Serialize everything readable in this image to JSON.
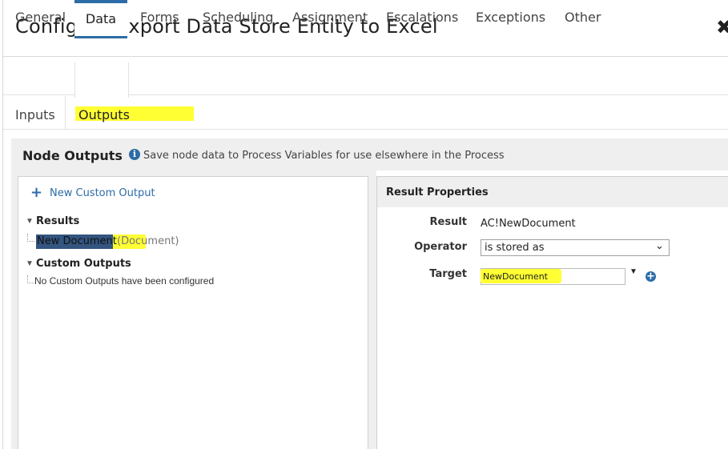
{
  "window": {
    "title": "Configure Export Data Store Entity to Excel",
    "close_glyph": "✖"
  },
  "tabs": [
    {
      "label": "General"
    },
    {
      "label": "Data"
    },
    {
      "label": "Forms"
    },
    {
      "label": "Scheduling"
    },
    {
      "label": "Assignment"
    },
    {
      "label": "Escalations"
    },
    {
      "label": "Exceptions"
    },
    {
      "label": "Other"
    }
  ],
  "active_tab": "Data",
  "subtabs": [
    {
      "label": "Inputs"
    },
    {
      "label": "Outputs"
    }
  ],
  "active_subtab": "Outputs",
  "node_outputs": {
    "title": "Node Outputs",
    "info": "Save node data to Process Variables for use elsewhere in the Process"
  },
  "tree": {
    "new_custom_output": "New Custom Output",
    "results_label": "Results",
    "result_item": {
      "name": "New Document",
      "type": "(Document)"
    },
    "custom_outputs_label": "Custom Outputs",
    "custom_empty": "No Custom Outputs have been configured"
  },
  "result_properties": {
    "title": "Result Properties",
    "result_label": "Result",
    "result_value": "AC!NewDocument",
    "operator_label": "Operator",
    "operator_value": "is stored as",
    "target_label": "Target",
    "target_value": "NewDocument"
  },
  "colors": {
    "accent": "#2d6ca7",
    "highlight": "#ffff33",
    "selection": "#335580"
  }
}
